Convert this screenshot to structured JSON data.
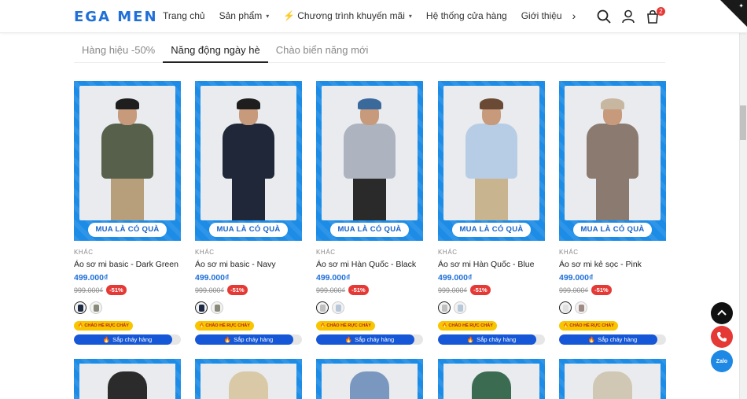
{
  "brand": {
    "logo": "EGA MEN"
  },
  "nav": {
    "items": [
      {
        "label": "Trang chủ",
        "dropdown": false,
        "bolt": false
      },
      {
        "label": "Sản phẩm",
        "dropdown": true,
        "bolt": false
      },
      {
        "label": "Chương trình khuyến mãi",
        "dropdown": true,
        "bolt": true
      },
      {
        "label": "Hệ thống cửa hàng",
        "dropdown": false,
        "bolt": false
      },
      {
        "label": "Giới thiệu",
        "dropdown": false,
        "bolt": false
      }
    ]
  },
  "header": {
    "cart_count": "2",
    "icons": [
      "search-icon",
      "user-icon",
      "cart-icon"
    ]
  },
  "tabs": [
    {
      "label": "Hàng hiệu -50%",
      "active": false
    },
    {
      "label": "Năng động ngày hè",
      "active": true
    },
    {
      "label": "Chào biển năng mới",
      "active": false
    }
  ],
  "products": [
    {
      "promo": "MUA LÀ CÓ QUÀ",
      "vendor": "KHÁC",
      "name": "Áo sơ mi basic - Dark Green",
      "price": "499.000₫",
      "old_price": "999.000₫",
      "discount": "-51%",
      "hot": "🔥 CHÀO HÈ RỰC CHÁY",
      "stock": "Sắp cháy hàng",
      "stock_level": 0.92,
      "colors": {
        "shirt": "#56604a",
        "legs": "#b79f7c",
        "hat": "#1e1e1e"
      },
      "swatches": [
        "#1d2a44",
        "#8a8a7a"
      ]
    },
    {
      "promo": "MUA LÀ CÓ QUÀ",
      "vendor": "KHÁC",
      "name": "Áo sơ mi basic - Navy",
      "price": "499.000₫",
      "old_price": "999.000₫",
      "discount": "-51%",
      "hot": "🔥 CHÀO HÈ RỰC CHÁY",
      "stock": "Sắp cháy hàng",
      "stock_level": 0.92,
      "colors": {
        "shirt": "#1f2738",
        "legs": "#1f2738",
        "hat": "#1e1e1e"
      },
      "swatches": [
        "#1d2a44",
        "#8a8a7a"
      ]
    },
    {
      "promo": "MUA LÀ CÓ QUÀ",
      "vendor": "KHÁC",
      "name": "Áo sơ mi Hàn Quốc - Black",
      "price": "499.000₫",
      "old_price": "999.000₫",
      "discount": "-51%",
      "hot": "🔥 CHÀO HÈ RỰC CHÁY",
      "stock": "Sắp cháy hàng",
      "stock_level": 0.92,
      "colors": {
        "shirt": "#aeb4bf",
        "legs": "#2a2a2a",
        "hat": "#3a6a9c"
      },
      "swatches": [
        "#bfbfbf",
        "#b7c7da"
      ]
    },
    {
      "promo": "MUA LÀ CÓ QUÀ",
      "vendor": "KHÁC",
      "name": "Áo sơ mi Hàn Quốc - Blue",
      "price": "499.000₫",
      "old_price": "999.000₫",
      "discount": "-51%",
      "hot": "🔥 CHÀO HÈ RỰC CHÁY",
      "stock": "Sắp cháy hàng",
      "stock_level": 0.92,
      "colors": {
        "shirt": "#b7cde6",
        "legs": "#c8b590",
        "hat": "#6b4a35"
      },
      "swatches": [
        "#bfbfbf",
        "#b7c7da"
      ]
    },
    {
      "promo": "MUA LÀ CÓ QUÀ",
      "vendor": "KHÁC",
      "name": "Áo sơ mi kẻ sọc - Pink",
      "price": "499.000₫",
      "old_price": "999.000₫",
      "discount": "-51%",
      "hot": "🔥 CHÀO HÈ RỰC CHÁY",
      "stock": "Sắp cháy hàng",
      "stock_level": 0.92,
      "colors": {
        "shirt": "#8a7a70",
        "legs": "#8a7a70",
        "hat": "#c8b7a0"
      },
      "swatches": [
        "#e0e0e0",
        "#a08a84"
      ]
    }
  ],
  "next_row_colors": [
    "#2b2b2b",
    "#d9c9a7",
    "#7a98bf",
    "#3b6b50",
    "#d0c7b4"
  ],
  "fabs": [
    {
      "icon": "scroll-top-icon",
      "color": "#111111"
    },
    {
      "icon": "phone-icon",
      "color": "#e53935"
    },
    {
      "icon": "zalo-icon",
      "label": "Zalo",
      "color": "#1e88e5"
    }
  ]
}
